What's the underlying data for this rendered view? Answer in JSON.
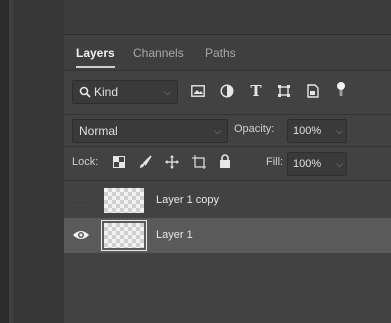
{
  "tabs": [
    {
      "label": "Layers",
      "active": true
    },
    {
      "label": "Channels",
      "active": false
    },
    {
      "label": "Paths",
      "active": false
    }
  ],
  "filter": {
    "label": "Kind",
    "icons": [
      "search-icon",
      "image-filter-icon",
      "adjustment-filter-icon",
      "type-filter-icon",
      "shape-filter-icon",
      "smart-object-filter-icon",
      "filter-toggle-icon"
    ]
  },
  "blend": {
    "mode": "Normal",
    "opacity_label": "Opacity:",
    "opacity_value": "100%"
  },
  "lock": {
    "label": "Lock:",
    "icons": [
      "lock-transparent-pixels-icon",
      "lock-image-pixels-icon",
      "lock-position-icon",
      "lock-artboard-icon",
      "lock-all-icon"
    ],
    "fill_label": "Fill:",
    "fill_value": "100%"
  },
  "layers": [
    {
      "name": "Layer 1 copy",
      "visible": false,
      "selected": false
    },
    {
      "name": "Layer 1",
      "visible": true,
      "selected": true
    }
  ],
  "colors": {
    "panel_bg": "#424242",
    "selected_row": "#5a5a5a",
    "text": "#e6e6e6"
  }
}
